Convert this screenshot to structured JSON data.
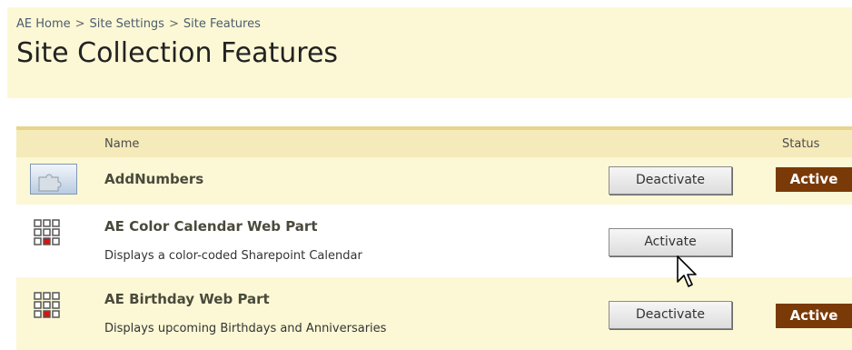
{
  "breadcrumb": {
    "items": [
      "AE Home",
      "Site Settings",
      "Site Features"
    ],
    "separator": ">"
  },
  "page": {
    "title": "Site Collection Features"
  },
  "table": {
    "headers": {
      "name": "Name",
      "status": "Status"
    }
  },
  "features": [
    {
      "title": "AddNumbers",
      "description": "",
      "action": "Deactivate",
      "status": "Active",
      "icon": "feature-puzzle-icon"
    },
    {
      "title": "AE Color Calendar Web Part",
      "description": "Displays a color-coded Sharepoint Calendar",
      "action": "Activate",
      "status": "",
      "icon": "calendar-grid-icon"
    },
    {
      "title": "AE Birthday Web Part",
      "description": "Displays upcoming Birthdays and Anniversaries",
      "action": "Deactivate",
      "status": "Active",
      "icon": "calendar-grid-icon"
    }
  ],
  "colors": {
    "header_bg": "#fcf8d5",
    "table_header_bg": "#f5eab9",
    "badge_active": "#7a3a07"
  }
}
